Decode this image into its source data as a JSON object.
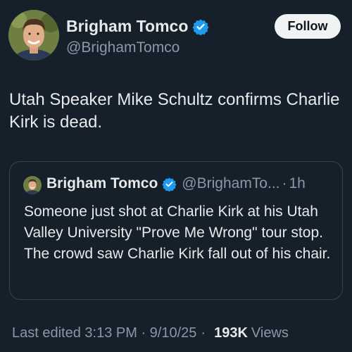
{
  "author": {
    "name": "Brigham Tomco",
    "handle": "@BrighamTomco",
    "verified": true
  },
  "follow_button": {
    "label": "Follow"
  },
  "tweet": {
    "text": "Utah Speaker Mike Schultz confirms Charlie Kirk is dead."
  },
  "quoted_tweet": {
    "name": "Brigham Tomco",
    "handle": "@BrighamTo...",
    "separator": "·",
    "time": "1h",
    "text": "Someone just shot at Charlie Kirk at his Utah Valley University \"Prove Me Wrong\" tour stop. The crowd saw Charlie Kirk fall out of his chair."
  },
  "meta": {
    "edited": "Last edited 3:13 PM · 9/10/25",
    "separator": "·",
    "views_count": "193K",
    "views_label": "Views"
  },
  "colors": {
    "background": "#15202b",
    "text": "#e7e9ea",
    "muted": "#8b98a5",
    "verified": "#1d9bf0",
    "border": "#38444d"
  },
  "icons": {
    "verified": "verified-badge-icon",
    "avatar": "profile-photo"
  }
}
